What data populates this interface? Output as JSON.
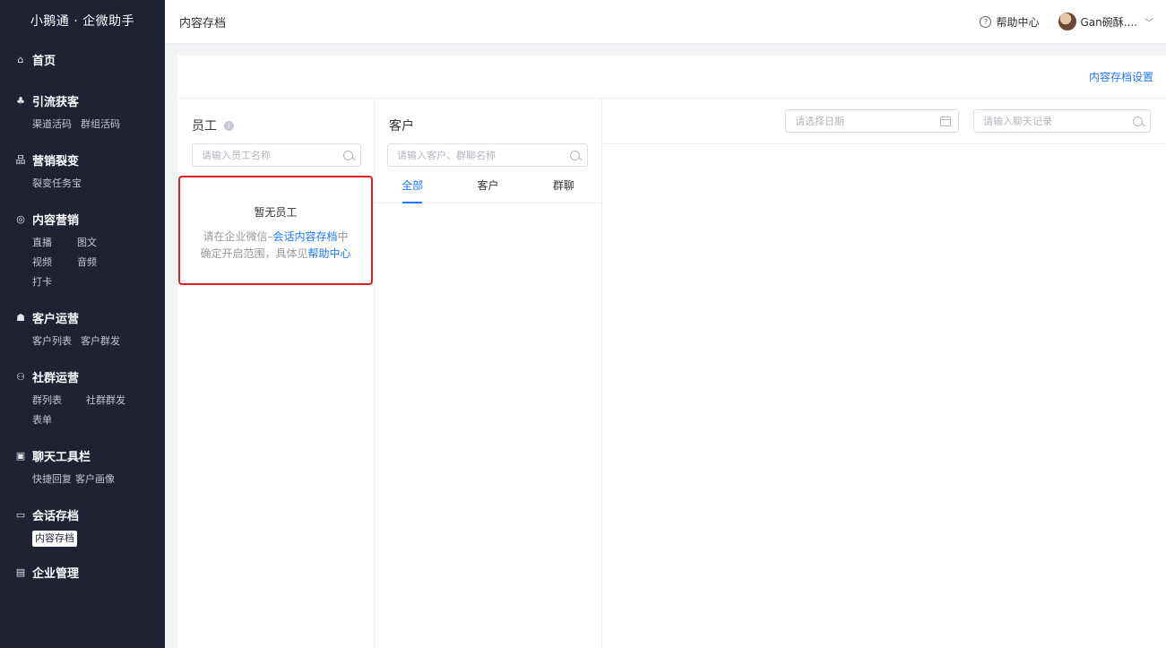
{
  "sidebar": {
    "brand": "小鹅通 · 企微助手",
    "groups": [
      {
        "title": "首页",
        "icon": "home-icon",
        "items": []
      },
      {
        "title": "引流获客",
        "icon": "network-icon",
        "items": [
          "渠道活码",
          "群组活码"
        ]
      },
      {
        "title": "营销裂变",
        "icon": "hierarchy-icon",
        "items": [
          "裂变任务宝"
        ]
      },
      {
        "title": "内容营销",
        "icon": "content-icon",
        "items": [
          "直播",
          "图文",
          "视频",
          "音频",
          "打卡"
        ]
      },
      {
        "title": "客户运营",
        "icon": "user-icon",
        "items": [
          "客户列表",
          "客户群发"
        ]
      },
      {
        "title": "社群运营",
        "icon": "group-icon",
        "items": [
          "群列表",
          "社群群发",
          "表单"
        ]
      },
      {
        "title": "聊天工具栏",
        "icon": "toolbar-icon",
        "items": [
          "快捷回复",
          "客户画像"
        ]
      },
      {
        "title": "会话存档",
        "icon": "chat-archive-icon",
        "items": [
          "内容存档"
        ]
      },
      {
        "title": "企业管理",
        "icon": "enterprise-icon",
        "items": []
      }
    ],
    "active_item": "内容存档"
  },
  "header": {
    "title": "内容存档",
    "help_label": "帮助中心",
    "user_name": "Gan碗酥...."
  },
  "main": {
    "settings_link": "内容存档设置",
    "employee": {
      "title": "员工",
      "search_placeholder": "请输入员工名称",
      "empty_title": "暂无员工",
      "empty_line1_prefix": "请在企业微信–",
      "empty_line1_link": "会话内容存档",
      "empty_line1_suffix": "中",
      "empty_line2_prefix": "确定开启范围，具体见",
      "empty_line2_link": "帮助中心"
    },
    "customer": {
      "title": "客户",
      "search_placeholder": "请输入客户、群聊名称",
      "tabs": [
        "全部",
        "客户",
        "群聊"
      ],
      "active_tab": "全部"
    },
    "chat": {
      "date_placeholder": "请选择日期",
      "search_placeholder": "请输入聊天记录"
    }
  },
  "colors": {
    "sidebar_bg": "#1e2233",
    "accent": "#1f78ff",
    "highlight_border": "#e02020"
  }
}
